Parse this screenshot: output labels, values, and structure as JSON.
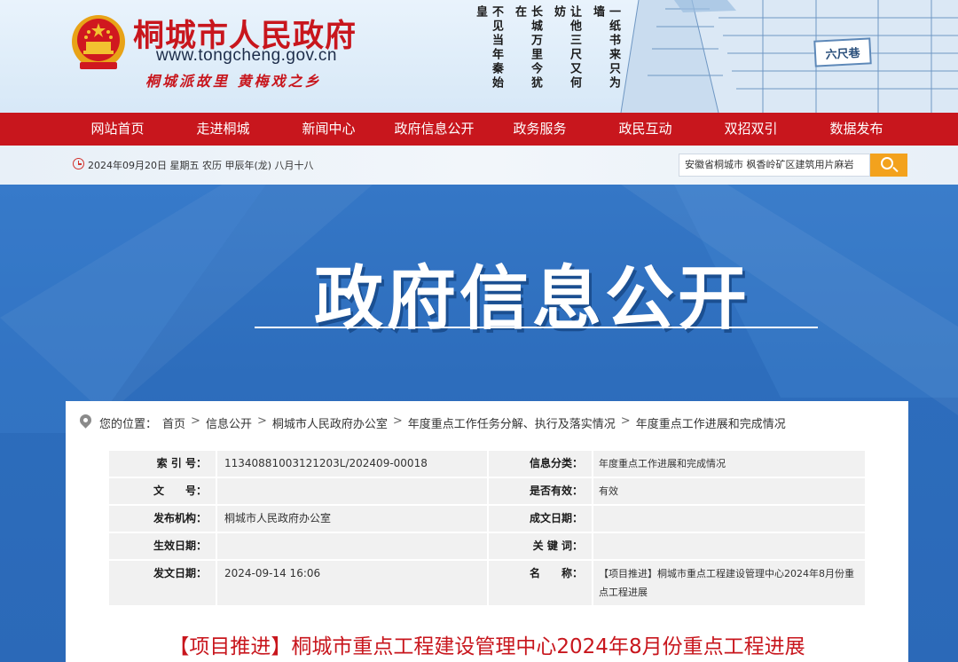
{
  "header": {
    "site_name": "桐城市人民政府",
    "site_url": "www.tongcheng.gov.cn",
    "slogan": "桐城派故里  黄梅戏之乡",
    "poem_columns": [
      "一纸书来只为墙",
      "让他三尺又何妨",
      "长城万里今犹在",
      "不见当年秦始皇"
    ],
    "lane_sign": "六尺巷",
    "emblem_icon": "national-emblem-icon"
  },
  "nav": {
    "items": [
      "网站首页",
      "走进桐城",
      "新闻中心",
      "政府信息公开",
      "政务服务",
      "政民互动",
      "双招双引",
      "数据发布"
    ]
  },
  "datebar": {
    "date": "2024年09月20日 星期五 农历 甲辰年(龙) 八月十八",
    "search_value": "安徽省桐城市  枫香岭矿区建筑用片麻岩",
    "clock_icon": "clock-icon",
    "search_icon": "search-icon"
  },
  "banner": {
    "title": "政府信息公开"
  },
  "breadcrumb": {
    "prefix": "您的位置：",
    "items": [
      "首页",
      "信息公开",
      "桐城市人民政府办公室",
      "年度重点工作任务分解、执行及落实情况",
      "年度重点工作进展和完成情况"
    ],
    "separator": ">"
  },
  "meta": {
    "rows": [
      {
        "label1": "索 引 号：",
        "value1": "11340881003121203L/202409-00018",
        "label2": "信息分类：",
        "value2": "年度重点工作进展和完成情况"
      },
      {
        "label1": "文　　号：",
        "value1": "",
        "label2": "是否有效：",
        "value2": "有效"
      },
      {
        "label1": "发布机构：",
        "value1": "桐城市人民政府办公室",
        "label2": "成文日期：",
        "value2": ""
      },
      {
        "label1": "生效日期：",
        "value1": "",
        "label2": "关 键 词：",
        "value2": ""
      },
      {
        "label1": "发文日期：",
        "value1": "2024-09-14 16:06",
        "label2": "名　　称：",
        "value2": "【项目推进】桐城市重点工程建设管理中心2024年8月份重点工程进展"
      }
    ]
  },
  "article": {
    "title": "【项目推进】桐城市重点工程建设管理中心2024年8月份重点工程进展"
  },
  "colors": {
    "brand_red": "#c8161d",
    "banner_blue": "#2f6fbf",
    "search_orange": "#f3a21d"
  }
}
